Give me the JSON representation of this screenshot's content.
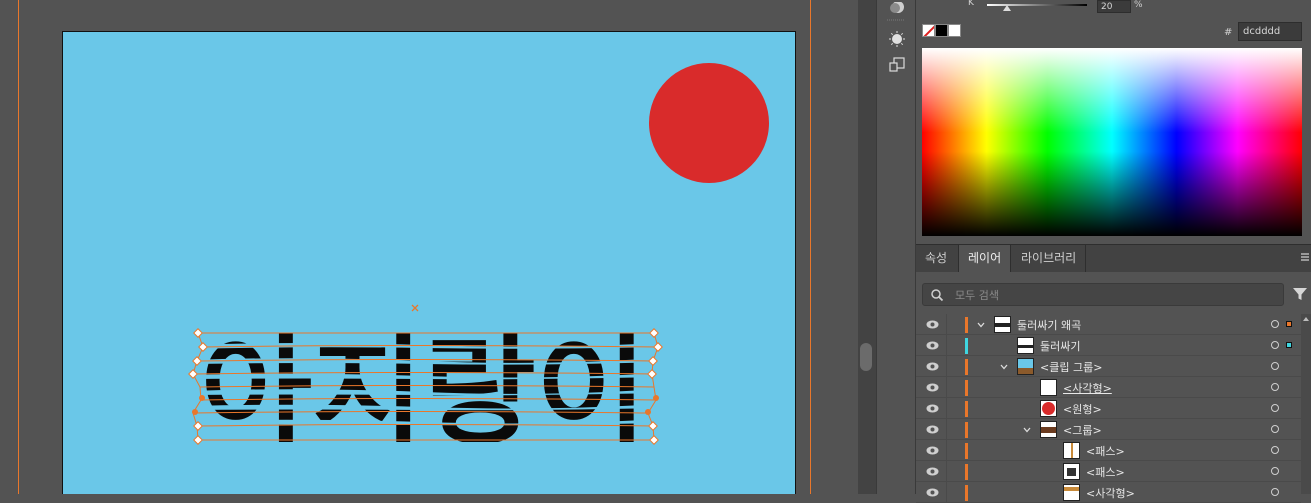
{
  "canvas": {
    "artboard_color": "#6ac7e8",
    "circle_color": "#d92b2b",
    "warp_text": "아지랑이",
    "selection_color": "#e9772b"
  },
  "color_panel": {
    "k_label": "K",
    "k_value": "20",
    "k_unit": "%",
    "k_level": 0.2,
    "hex_hash": "#",
    "hex_value": "dcdddd"
  },
  "tabs": {
    "properties": "속성",
    "layers": "레이어",
    "libraries": "라이브러리"
  },
  "search": {
    "placeholder": "모두 검색"
  },
  "layers": [
    {
      "label": "둘러싸기 왜곡",
      "color": "#e9772b",
      "underline": false
    },
    {
      "label": "둘러싸기",
      "color": "#3fd6e0",
      "underline": false
    },
    {
      "label": "<클립 그룹>",
      "color": "#e9772b",
      "underline": false
    },
    {
      "label": "<사각형>",
      "color": "#e9772b",
      "underline": true
    },
    {
      "label": "<원형>",
      "color": "#e9772b",
      "underline": false
    },
    {
      "label": "<그룹>",
      "color": "#e9772b",
      "underline": false
    },
    {
      "label": "<패스>",
      "color": "#e9772b",
      "underline": false
    },
    {
      "label": "<패스>",
      "color": "#e9772b",
      "underline": false
    },
    {
      "label": "<사각형>",
      "color": "#e9772b",
      "underline": false
    }
  ]
}
